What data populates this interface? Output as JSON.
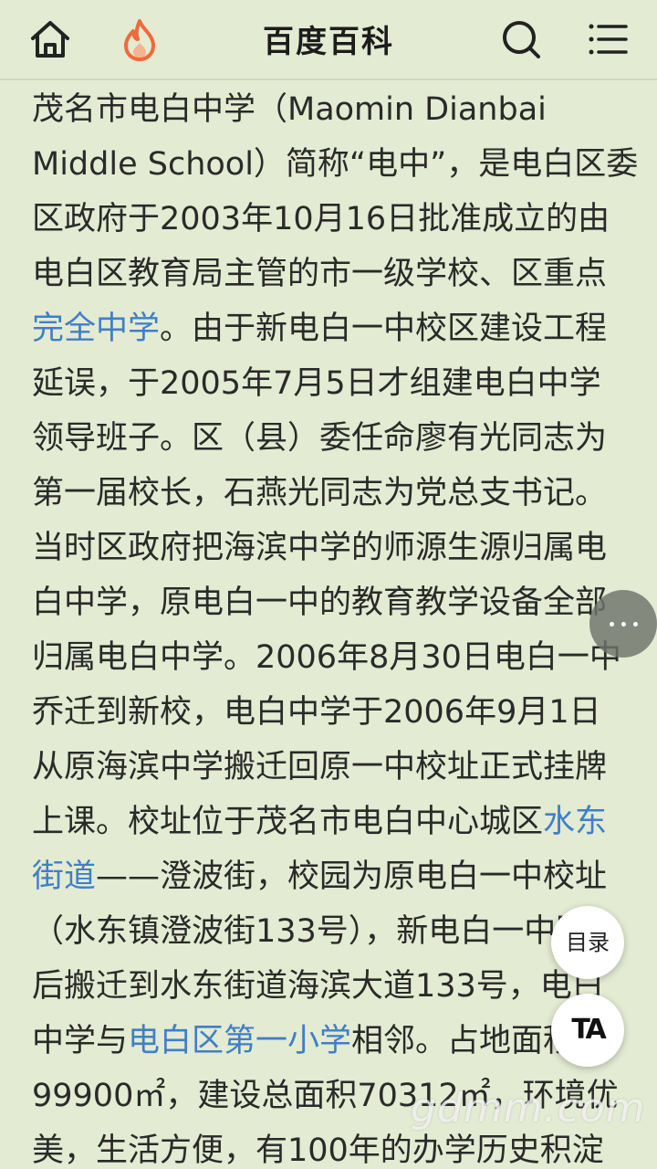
{
  "header": {
    "title": "百度百科",
    "icons": [
      "home-icon",
      "flame-icon",
      "search-icon",
      "menu-icon"
    ]
  },
  "article": {
    "lines": [
      [
        {
          "text": "茂名市电白中学（Maomin Dianbai"
        }
      ],
      [
        {
          "text": "Middle School）简称“电中”，是电白区委"
        }
      ],
      [
        {
          "text": "区政府于2003年10月16日批准成立的由"
        }
      ],
      [
        {
          "text": "电白区教育局主管的市一级学校、区重点"
        }
      ],
      [
        {
          "text": "完全中学",
          "link": true
        },
        {
          "text": "。由于新电白一中校区建设工程"
        }
      ],
      [
        {
          "text": "延误，于2005年7月5日才组建电白中学"
        }
      ],
      [
        {
          "text": "领导班子。区（县）委任命廖有光同志为"
        }
      ],
      [
        {
          "text": "第一届校长，石燕光同志为党总支书记。"
        }
      ],
      [
        {
          "text": "当时区政府把海滨中学的师源生源归属电"
        }
      ],
      [
        {
          "text": "白中学，原电白一中的教育教学设备全部"
        }
      ],
      [
        {
          "text": "归属电白中学。2006年8月30日电白一中"
        }
      ],
      [
        {
          "text": "乔迁到新校，电白中学于2006年9月1日"
        }
      ],
      [
        {
          "text": "从原海滨中学搬迁回原一中校址正式挂牌"
        }
      ],
      [
        {
          "text": "上课。校址位于茂名市电白中心城区"
        },
        {
          "text": "水东",
          "link": true
        }
      ],
      [
        {
          "text": "街道",
          "link": true
        },
        {
          "text": "——澄波街，校园为原电白一中校址"
        }
      ],
      [
        {
          "text": "（水东镇澄波街133号），新电白一中随"
        }
      ],
      [
        {
          "text": "后搬迁到水东街道海滨大道133号，电白"
        }
      ],
      [
        {
          "text": "中学与"
        },
        {
          "text": "电白区第一小学",
          "link": true
        },
        {
          "text": "相邻。占地面积"
        }
      ],
      [
        {
          "text": "99900㎡，建设总面积70312㎡，环境优"
        }
      ],
      [
        {
          "text": "美，生活方便，有100年的办学历史积淀"
        }
      ]
    ]
  },
  "floating": {
    "more_icon": "more-horizontal-icon",
    "toc_label": "目录",
    "ta_label": "TA"
  },
  "watermark": {
    "text": "gdmm.com"
  },
  "colors": {
    "background": "#e3ebd2",
    "link": "#3f7fc8",
    "text": "#2a2a2a"
  }
}
